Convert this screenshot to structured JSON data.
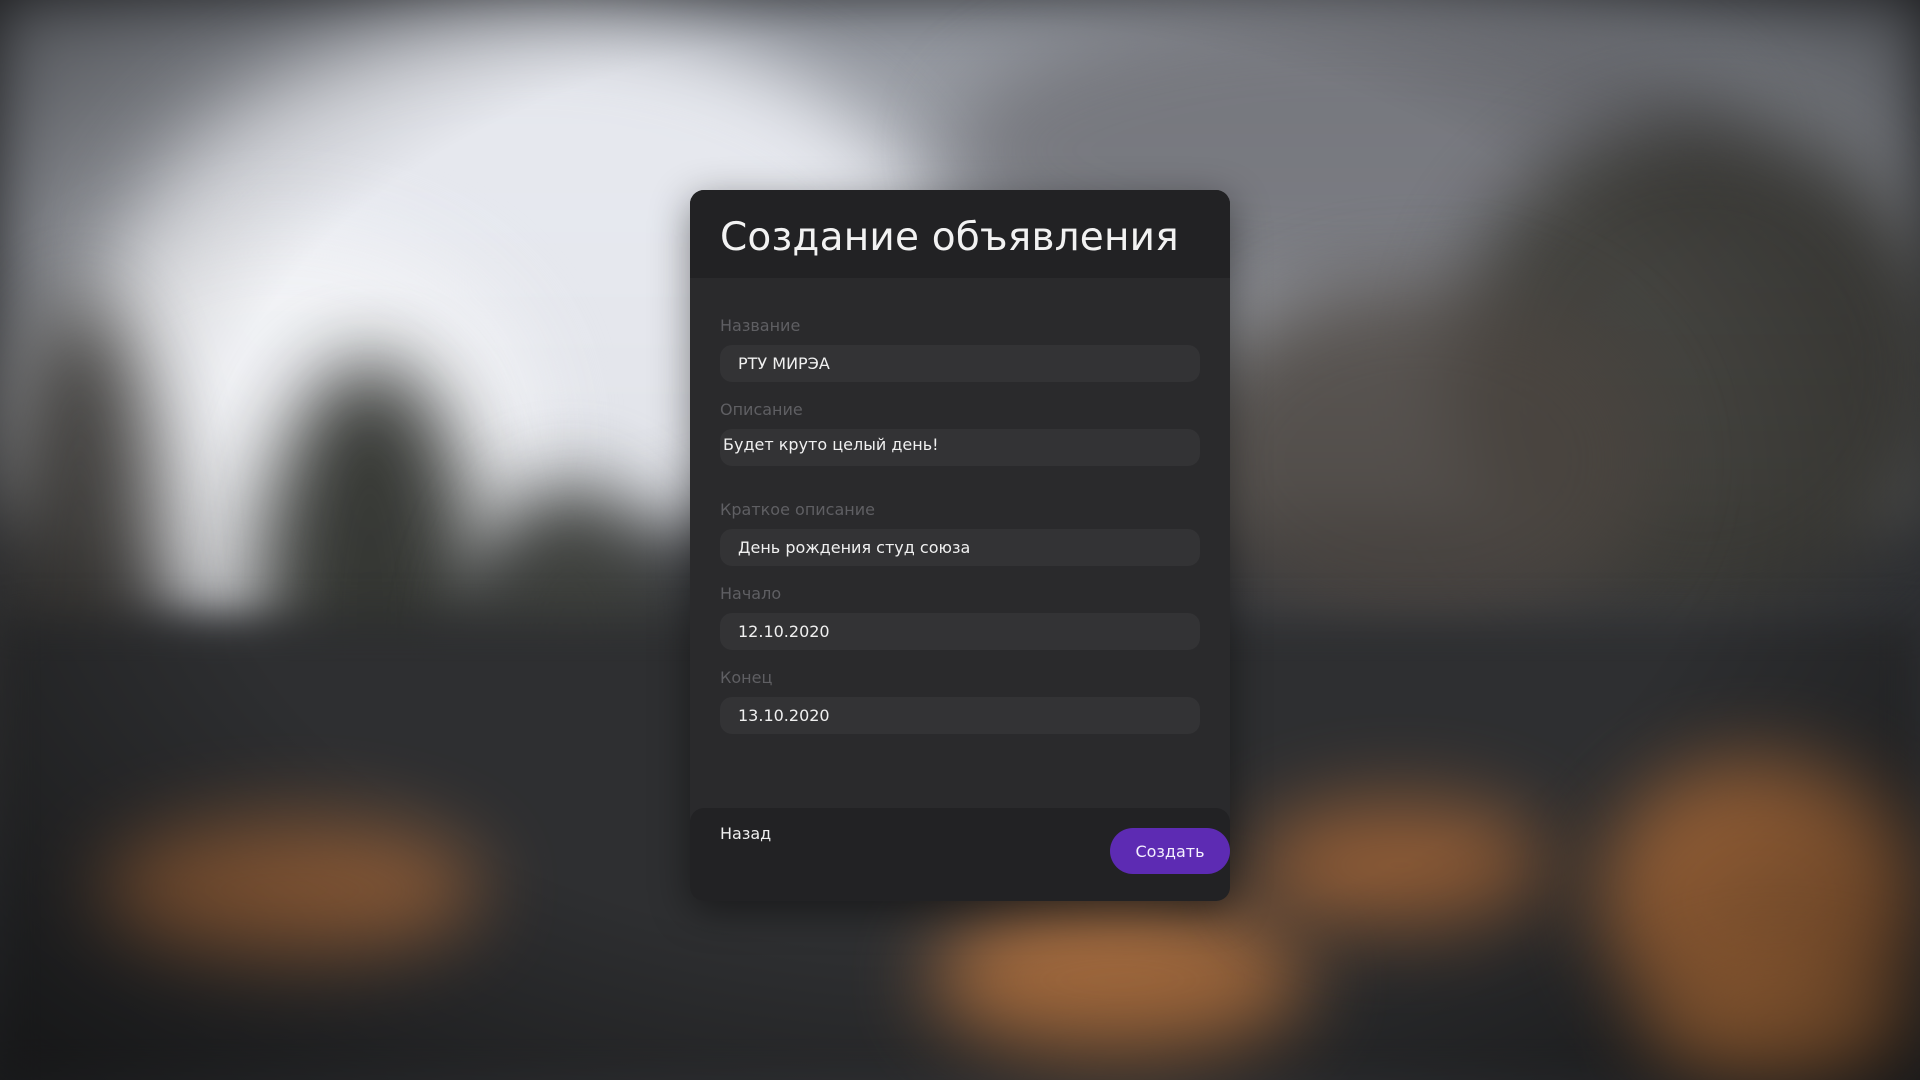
{
  "modal": {
    "title": "Создание объявления"
  },
  "form": {
    "fields": [
      {
        "label": "Название",
        "value": "РТУ МИРЭА"
      },
      {
        "label": "Описание",
        "value": "Будет круто целый день!"
      },
      {
        "label": "Краткое описание",
        "value": "День рождения студ союза"
      },
      {
        "label": "Начало",
        "value": "12.10.2020"
      },
      {
        "label": "Конец",
        "value": "13.10.2020"
      }
    ]
  },
  "footer": {
    "back_label": "Назад",
    "create_label": "Создать"
  },
  "colors": {
    "accent": "#5d2bb3",
    "panel": "#2a2a2c",
    "header": "#222224",
    "input": "#333335"
  }
}
